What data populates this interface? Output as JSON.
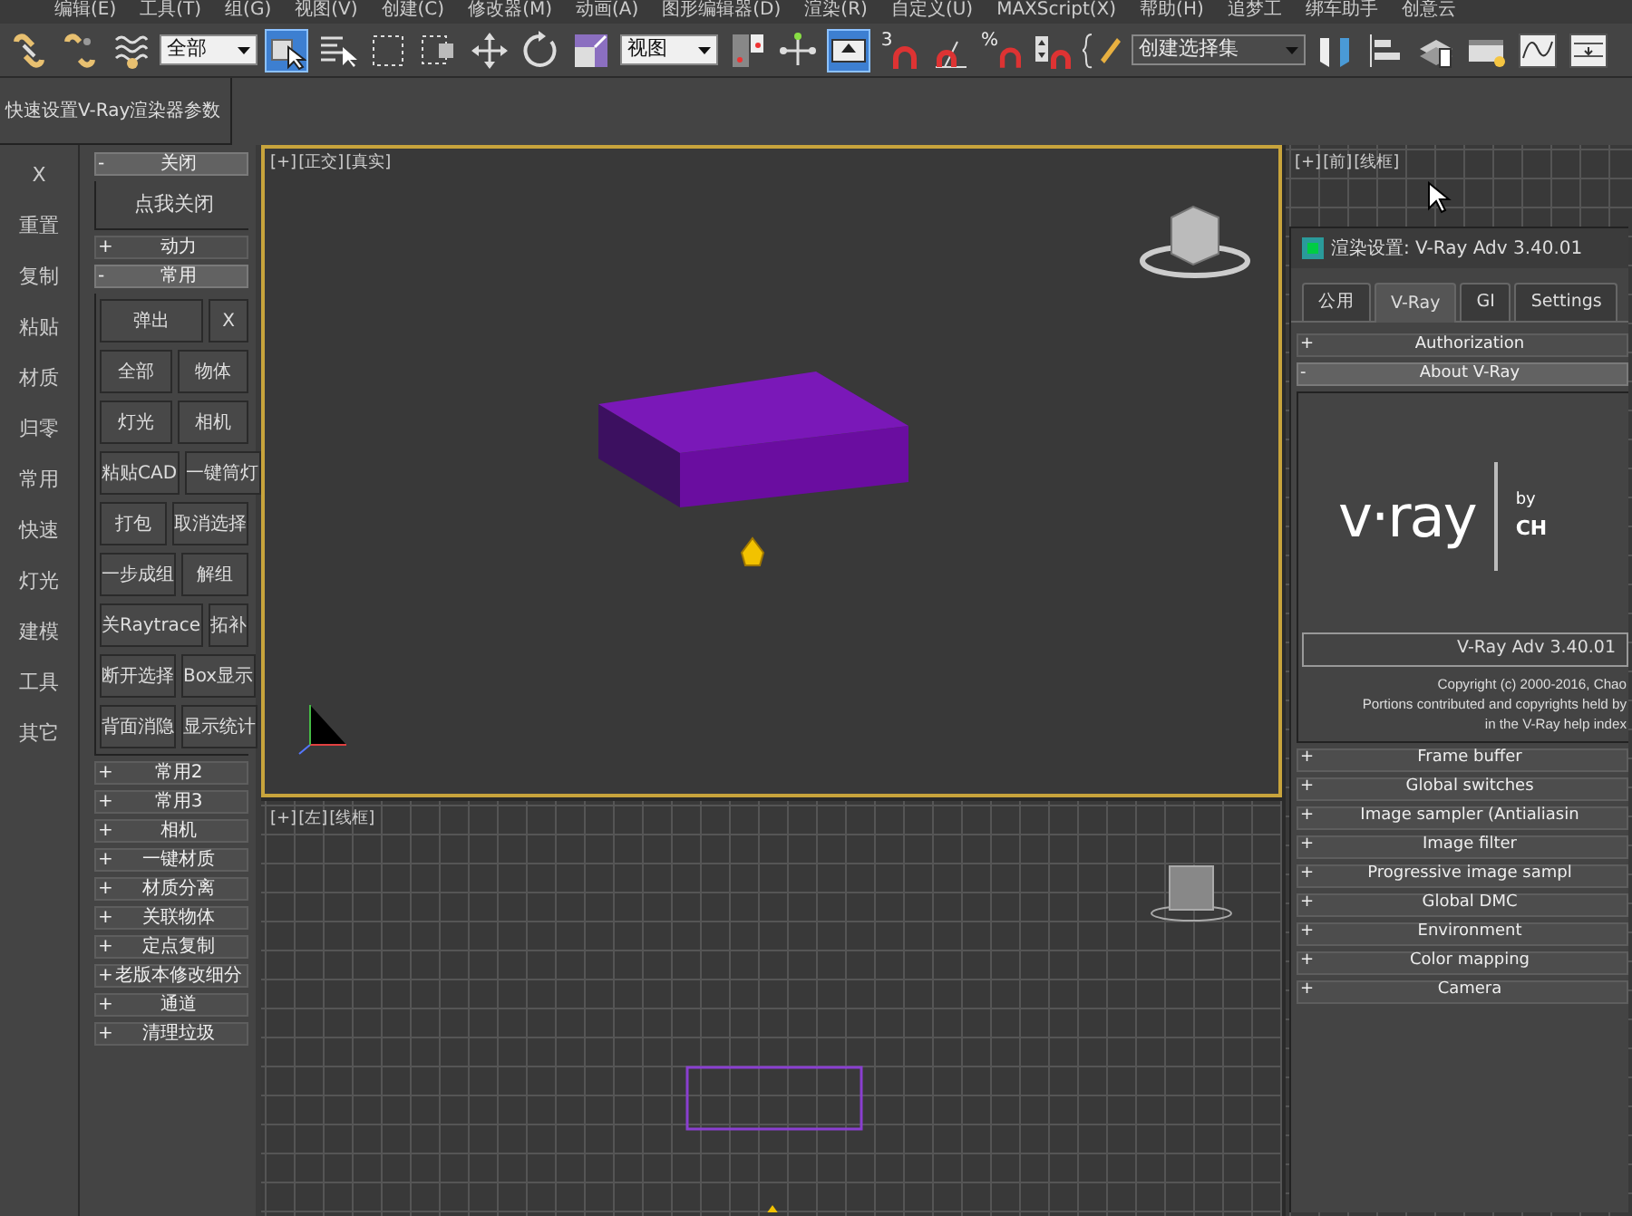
{
  "menu_bar": {
    "items": [
      "编辑(E)",
      "工具(T)",
      "组(G)",
      "视图(V)",
      "创建(C)",
      "修改器(M)",
      "动画(A)",
      "图形编辑器(D)",
      "渲染(R)",
      "自定义(U)",
      "MAXScript(X)",
      "帮助(H)",
      "追梦工",
      "绑车助手",
      "创意云"
    ]
  },
  "toolbar": {
    "items": [
      {
        "kind": "link",
        "selected": false
      },
      {
        "kind": "unlink",
        "selected": false
      },
      {
        "kind": "bind",
        "selected": false
      },
      {
        "kind": "dropdown",
        "value": "全部"
      },
      {
        "kind": "select",
        "selected": true
      },
      {
        "kind": "select-name",
        "selected": false
      },
      {
        "kind": "region",
        "selected": false
      },
      {
        "kind": "window",
        "selected": false
      },
      {
        "kind": "move",
        "selected": false
      },
      {
        "kind": "rotate",
        "selected": false
      },
      {
        "kind": "scale",
        "selected": false
      },
      {
        "kind": "dropdown",
        "value": "视图"
      },
      {
        "kind": "pivot",
        "selected": false
      },
      {
        "kind": "manipulate",
        "selected": false
      },
      {
        "kind": "override",
        "selected": true
      },
      {
        "kind": "snap",
        "glyph": "3",
        "selected": false
      },
      {
        "kind": "angle-snap",
        "selected": false
      },
      {
        "kind": "snap",
        "glyph": "%",
        "selected": false
      },
      {
        "kind": "spinner-snap",
        "selected": false
      },
      {
        "kind": "named-sets",
        "selected": false
      },
      {
        "kind": "dropdown",
        "placeholder": "创建选择集"
      },
      {
        "kind": "mirror",
        "selected": false
      },
      {
        "kind": "align",
        "selected": false
      },
      {
        "kind": "layers",
        "selected": false
      },
      {
        "kind": "explorer",
        "selected": false
      },
      {
        "kind": "curve",
        "selected": false
      },
      {
        "kind": "schematic",
        "selected": false
      }
    ]
  },
  "script_panel": {
    "title": "快速设置V-Ray渲染器参数"
  },
  "side_buttons": [
    "X",
    "重置",
    "复制",
    "粘贴",
    "材质",
    "归零",
    "常用",
    "快速",
    "灯光",
    "建模",
    "工具",
    "其它"
  ],
  "rollouts": [
    {
      "sign": "-",
      "label": "关闭",
      "expanded": true,
      "rows": [
        [
          "点我关闭"
        ]
      ]
    },
    {
      "sign": "+",
      "label": "动力",
      "expanded": false
    },
    {
      "sign": "-",
      "label": "常用",
      "expanded": true,
      "rows": [
        [
          "弹出",
          "X"
        ],
        [
          "全部",
          "物体"
        ],
        [
          "灯光",
          "相机"
        ],
        [
          "粘贴CAD",
          "一键筒灯"
        ],
        [
          "打包",
          "取消选择"
        ],
        [
          "一步成组",
          "解组"
        ],
        [
          "关Raytrace",
          "拓补"
        ],
        [
          "断开选择",
          "Box显示"
        ],
        [
          "背面消隐",
          "显示统计"
        ]
      ]
    },
    {
      "sign": "+",
      "label": "常用2",
      "expanded": false
    },
    {
      "sign": "+",
      "label": "常用3",
      "expanded": false
    },
    {
      "sign": "+",
      "label": "相机",
      "expanded": false
    },
    {
      "sign": "+",
      "label": "一键材质",
      "expanded": false
    },
    {
      "sign": "+",
      "label": "材质分离",
      "expanded": false
    },
    {
      "sign": "+",
      "label": "关联物体",
      "expanded": false
    },
    {
      "sign": "+",
      "label": "定点复制",
      "expanded": false
    },
    {
      "sign": "+",
      "label": "老版本修改细分",
      "expanded": false
    },
    {
      "sign": "+",
      "label": "通道",
      "expanded": false
    },
    {
      "sign": "+",
      "label": "清理垃圾",
      "expanded": false
    }
  ],
  "viewports": [
    {
      "labels": [
        "[+]",
        "[正交]",
        "[真实]"
      ],
      "kind": "shaded",
      "active": true
    },
    {
      "labels": [
        "[+]",
        "[前]",
        "[线框]"
      ],
      "kind": "wire-front",
      "active": false
    },
    {
      "labels": [
        "[+]",
        "[左]",
        "[线框]"
      ],
      "kind": "wire-left",
      "active": false
    }
  ],
  "render_dialog": {
    "title": "渲染设置: V-Ray Adv 3.40.01",
    "tabs": [
      {
        "label": "公用",
        "selected": false
      },
      {
        "label": "V-Ray",
        "selected": true
      },
      {
        "label": "GI",
        "selected": false
      },
      {
        "label": "Settings",
        "selected": false
      }
    ],
    "rollouts": [
      {
        "sign": "+",
        "label": "Authorization",
        "expanded": false
      },
      {
        "sign": "-",
        "label": "About V-Ray",
        "expanded": true
      },
      {
        "sign": "+",
        "label": "Frame buffer",
        "expanded": false
      },
      {
        "sign": "+",
        "label": "Global switches",
        "expanded": false
      },
      {
        "sign": "+",
        "label": "Image sampler (Antialiasin",
        "expanded": false
      },
      {
        "sign": "+",
        "label": "Image filter",
        "expanded": false
      },
      {
        "sign": "+",
        "label": "Progressive image sampl",
        "expanded": false
      },
      {
        "sign": "+",
        "label": "Global DMC",
        "expanded": false
      },
      {
        "sign": "+",
        "label": "Environment",
        "expanded": false
      },
      {
        "sign": "+",
        "label": "Color mapping",
        "expanded": false
      },
      {
        "sign": "+",
        "label": "Camera",
        "expanded": false
      }
    ],
    "about": {
      "logo": "v·ray",
      "by": "by",
      "maker": "CH",
      "version": "V-Ray Adv 3.40.01",
      "copyright": [
        "Copyright (c) 2000-2016, Chao",
        "Portions contributed and copyrights held by",
        "in the V-Ray help index"
      ]
    }
  }
}
